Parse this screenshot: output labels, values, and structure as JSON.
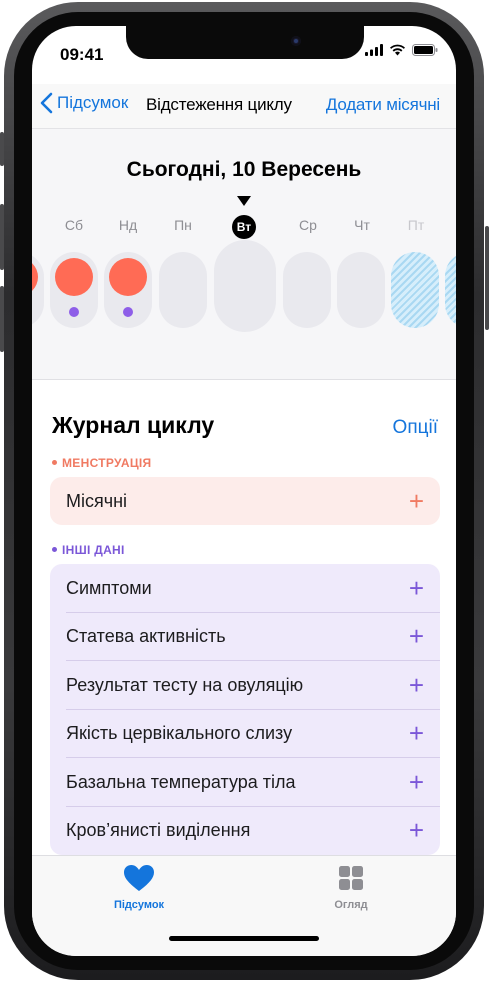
{
  "status_bar": {
    "time": "09:41"
  },
  "nav": {
    "back_label": "Підсумок",
    "title": "Відстеження циклу",
    "action_label": "Додати місячні"
  },
  "calendar": {
    "date_title": "Сьогодні, 10 Вересень",
    "days": [
      "Сб",
      "Нд",
      "Пн",
      "Вт",
      "Ср",
      "Чт",
      "Пт"
    ],
    "today_label": "Вт"
  },
  "log": {
    "title": "Журнал циклу",
    "options_label": "Опції",
    "menstruation_section": "МЕНСТРУАЦІЯ",
    "menstruation_item": "Місячні",
    "other_section": "ІНШІ ДАНІ",
    "other_items": [
      "Симптоми",
      "Статева активність",
      "Результат тесту на овуляцію",
      "Якість цервікального слизу",
      "Базальна температура тіла",
      "Кров’янисті виділення"
    ],
    "add_symbol": "+"
  },
  "tabs": {
    "summary_label": "Підсумок",
    "browse_label": "Огляд"
  },
  "colors": {
    "accent_blue": "#1475dc",
    "menstruation": "#f07a62",
    "other_data": "#7b57d8",
    "period_dot": "#ff6b55",
    "fertile_dot": "#8e5ee8",
    "predicted_hatch": "#a9d8f2"
  }
}
